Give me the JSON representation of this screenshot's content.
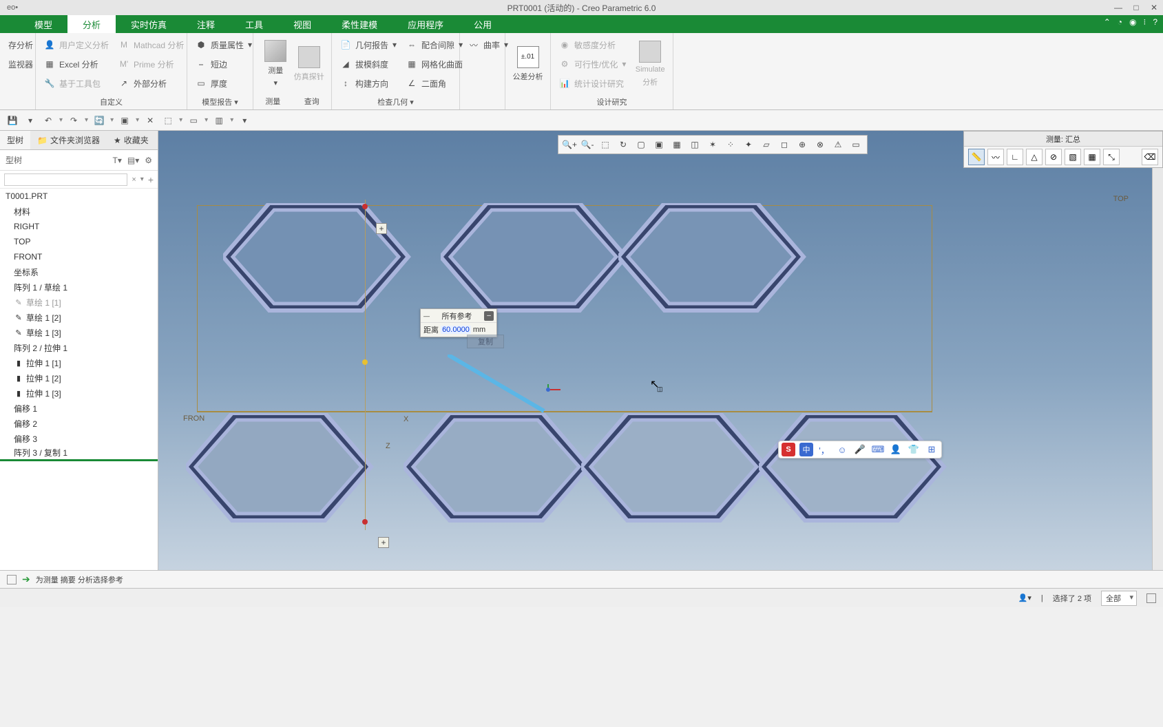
{
  "window": {
    "logo": "eo•",
    "title": "PRT0001 (活动的) - Creo Parametric 6.0",
    "min": "—",
    "max": "□",
    "close": "✕"
  },
  "tabs": {
    "model": "模型",
    "analysis": "分析",
    "rtsim": "实时仿真",
    "annotate": "注释",
    "tools": "工具",
    "view": "视图",
    "flex": "柔性建模",
    "app": "应用程序",
    "common": "公用"
  },
  "ribbon": {
    "g1": {
      "a": "存分析",
      "b": "监视器",
      "label": ""
    },
    "g2": {
      "a": "用户定义分析",
      "b": "Excel 分析",
      "c": "基于工具包",
      "label": "自定义"
    },
    "g3": {
      "a": "Mathcad 分析",
      "b": "Prime 分析",
      "c": "外部分析"
    },
    "g4": {
      "a": "质量属性",
      "b": "短边",
      "c": "厚度",
      "label": "模型报告"
    },
    "g5": {
      "measure": "测量",
      "probe": "仿真探针",
      "label_m": "测量",
      "label_q": "查询"
    },
    "g6": {
      "a": "几何报告",
      "b": "拔模斜度",
      "c": "构建方向",
      "label": ""
    },
    "g7": {
      "a": "配合间隙",
      "b": "网格化曲面",
      "c": "二面角",
      "label": "检查几何"
    },
    "g8": {
      "a": "曲率"
    },
    "g9": {
      "tol": "公差分析",
      "label": ""
    },
    "g10": {
      "a": "敏感度分析",
      "b": "可行性/优化",
      "c": "统计设计研究",
      "sim": "Simulate",
      "sim2": "分析",
      "label": "设计研究"
    }
  },
  "leftTabs": {
    "tree": "型树",
    "folder": "文件夹浏览器",
    "fav": "收藏夹",
    "sub": "型树"
  },
  "tree": {
    "root": "T0001.PRT",
    "n1": "材料",
    "n2": "RIGHT",
    "n3": "TOP",
    "n4": "FRONT",
    "n5": "坐标系",
    "n6": "阵列 1 / 草绘 1",
    "n7": "草绘 1 [1]",
    "n8": "草绘 1 [2]",
    "n9": "草绘 1 [3]",
    "n10": "阵列 2 / 拉伸 1",
    "n11": "拉伸 1 [1]",
    "n12": "拉伸 1 [2]",
    "n13": "拉伸 1 [3]",
    "n14": "偏移 1",
    "n15": "偏移 2",
    "n16": "偏移 3",
    "n17": "阵列 3 / 复制 1"
  },
  "viewport": {
    "top": "TOP",
    "front": "FRON",
    "x": "X",
    "z": "Z"
  },
  "measure": {
    "head": "所有参考",
    "dist_label": "距离",
    "dist_val": "60.0000",
    "dist_unit": "mm",
    "copy": "复制"
  },
  "floatPanel": {
    "title": "测量: 汇总"
  },
  "overlay": {
    "cn": "中"
  },
  "status": {
    "msg": "为测量 摘要 分析选择参考",
    "sel": "选择了 2 项",
    "filter": "全部"
  },
  "hex": {
    "outer": "0,78 67,0 202,0 269,78 202,156 67,156",
    "inner": "14,78 74,10 195,10 255,78 195,146 74,146"
  }
}
